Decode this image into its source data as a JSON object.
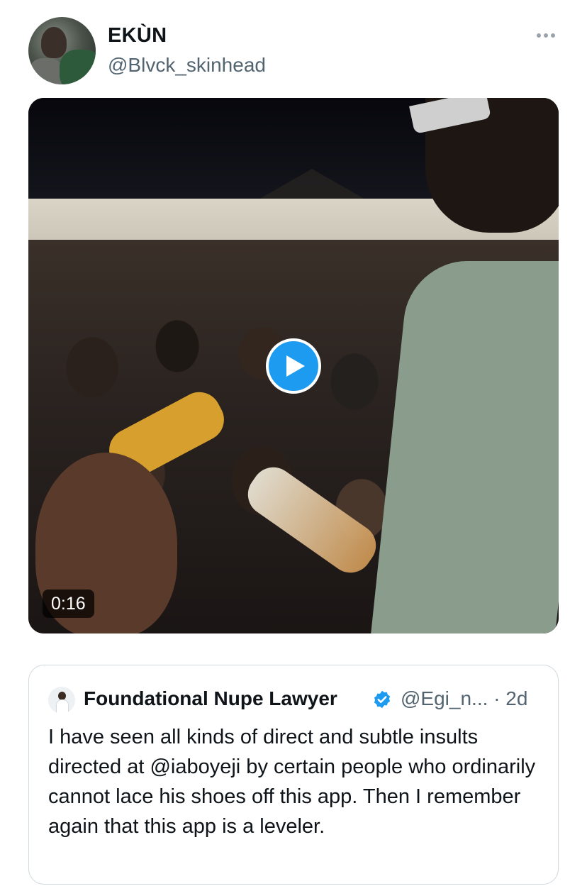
{
  "tweet": {
    "author_name": "EKÙN",
    "author_handle": "@Blvck_skinhead",
    "more_icon": "more-horizontal-icon",
    "media": {
      "type": "video",
      "duration": "0:16",
      "play_icon": "play-icon"
    }
  },
  "quoted_tweet": {
    "author_name": "Foundational Nupe Lawyer",
    "verified_icon": "verified-badge-icon",
    "handle_time": "@Egi_n... · 2d",
    "text": "I have seen all kinds of direct and subtle insults directed at @iaboyeji by certain people who ordinarily cannot lace his shoes off this app. Then I remember again that this app is a leveler."
  },
  "colors": {
    "accent": "#1d9bf0",
    "text_primary": "#0f1419",
    "text_secondary": "#536471",
    "border": "#cfd9de"
  }
}
